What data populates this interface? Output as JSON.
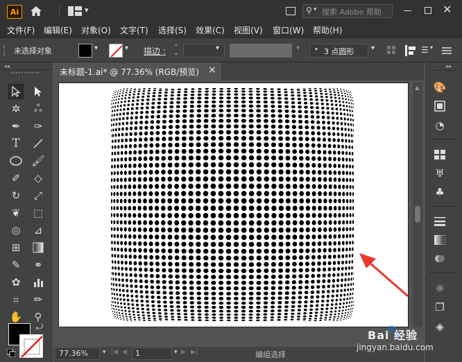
{
  "app": {
    "logo_text": "Ai"
  },
  "search": {
    "placeholder": "搜索 Adobe 帮助"
  },
  "menu": [
    "文件(F)",
    "编辑(E)",
    "对象(O)",
    "文字(T)",
    "选择(S)",
    "效果(C)",
    "视图(V)",
    "窗口(W)",
    "帮助(H)"
  ],
  "control": {
    "status": "未选择对象",
    "stroke_label": "描边 :",
    "brush_value": "3 点圆形"
  },
  "tab": {
    "title": "未标题-1.ai* @ 77.36% (RGB/预览)",
    "close": "×"
  },
  "statusbar": {
    "zoom": "77.36%",
    "page": "1",
    "mode": "编组选择"
  },
  "watermark": {
    "brand": "Bai 经验",
    "url": "jingyan.baidu.com"
  },
  "colors": {
    "accent_logo": "#ff9a00",
    "arrow": "#e8392b"
  }
}
